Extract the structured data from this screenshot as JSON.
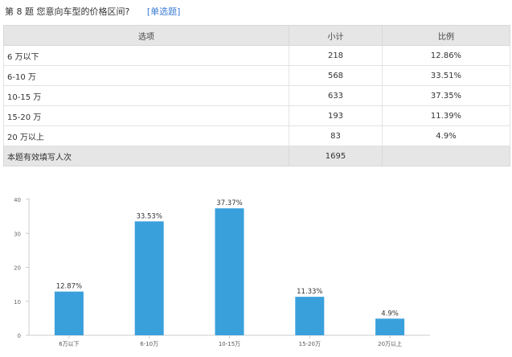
{
  "question": {
    "title": "第 8 题   您意向车型的价格区间?",
    "type": "[单选题]"
  },
  "table": {
    "headers": [
      "选项",
      "小计",
      "比例"
    ],
    "rows": [
      {
        "option": "6 万以下",
        "count": "218",
        "ratio": "12.86%"
      },
      {
        "option": "6-10 万",
        "count": "568",
        "ratio": "33.51%"
      },
      {
        "option": "10-15 万",
        "count": "633",
        "ratio": "37.35%"
      },
      {
        "option": "15-20 万",
        "count": "193",
        "ratio": "11.39%"
      },
      {
        "option": "20 万以上",
        "count": "83",
        "ratio": "4.9%"
      }
    ],
    "total": {
      "label": "本题有效填写人次",
      "count": "1695",
      "ratio": ""
    }
  },
  "chart_data": {
    "type": "bar",
    "categories": [
      "6万以下",
      "6-10万",
      "10-15万",
      "15-20万",
      "20万以上"
    ],
    "values": [
      12.87,
      33.53,
      37.37,
      11.33,
      4.9
    ],
    "data_labels": [
      "12.87%",
      "33.53%",
      "37.37%",
      "11.33%",
      "4.9%"
    ],
    "yticks": [
      0,
      10,
      20,
      30,
      40
    ],
    "ylim": [
      0,
      40
    ],
    "grid": false,
    "bar_color": "#3aa0dc",
    "axis_color": "#cccccc"
  }
}
